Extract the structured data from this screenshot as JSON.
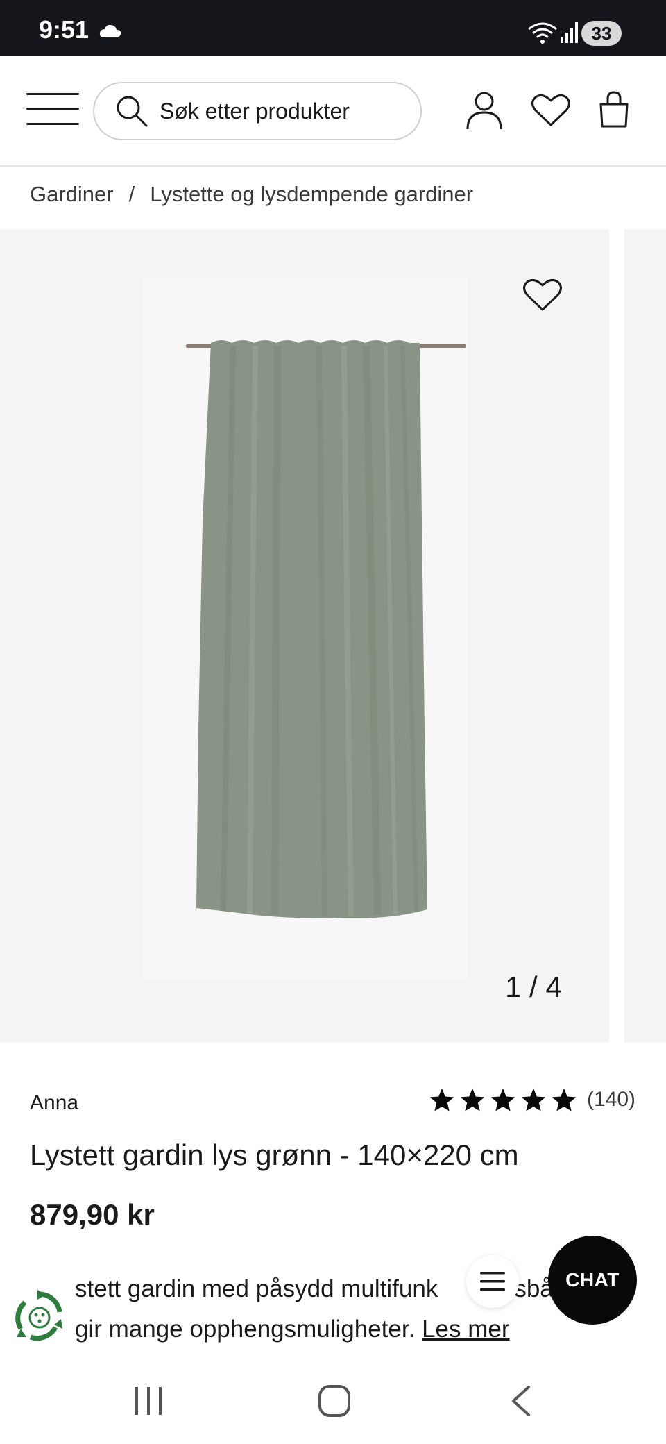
{
  "status_bar": {
    "time": "9:51",
    "battery": "33"
  },
  "header": {
    "search_placeholder": "Søk etter produkter"
  },
  "breadcrumb": {
    "items": [
      "Gardiner",
      "Lystette og lysdempende gardiner"
    ],
    "separator": "/"
  },
  "gallery": {
    "counter": "1 / 4",
    "current_image": 1,
    "total_images": 4
  },
  "product": {
    "brand": "Anna",
    "rating_stars": 5,
    "rating_count": "(140)",
    "title": "Lystett gardin lys grønn - 140×220 cm",
    "price": "879,90 kr",
    "description_line1": "stett gardin med påsydd multifunk",
    "description_line1_tail": "sbå",
    "description_line2": "gir mange opphengsmuligheter.",
    "read_more": "Les mer"
  },
  "floating": {
    "chat_label": "CHAT"
  },
  "colors": {
    "status_bar_bg": "#15161b",
    "gallery_bg": "#f4f4f4",
    "curtain_green": "#8a9486",
    "chat_bg": "#0a0a0a",
    "eco_green": "#2e7d3e"
  },
  "icons": [
    "cloud-icon",
    "wifi-icon",
    "signal-icon",
    "menu-icon",
    "search-icon",
    "user-icon",
    "heart-icon",
    "bag-icon",
    "star-icon",
    "recycle-icon",
    "hamburger-icon",
    "recent-apps-icon",
    "home-icon",
    "back-icon"
  ]
}
